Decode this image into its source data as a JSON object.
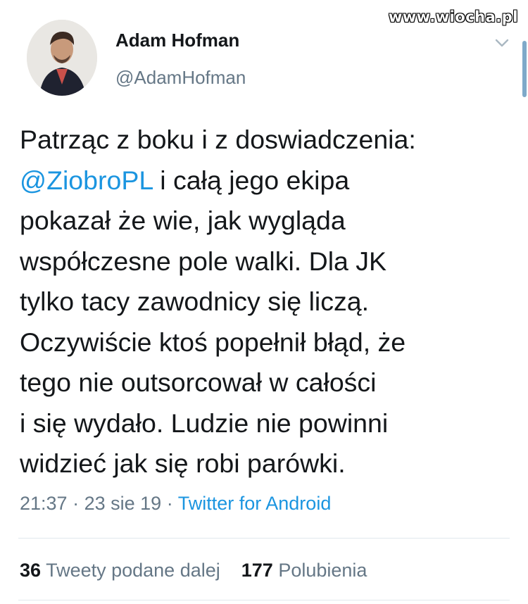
{
  "watermark": "www.wiocha.pl",
  "author": {
    "name": "Adam Hofman",
    "handle": "@AdamHofman"
  },
  "tweet": {
    "lines": [
      "Patrząc z boku i z doswiadczenia:",
      "i całą jego ekipa",
      "pokazał że wie, jak wygląda",
      "współczesne pole walki. Dla JK",
      "tylko tacy zawodnicy się liczą.",
      "Oczywiście ktoś popełnił błąd, że",
      "tego nie outsorcował w całości",
      "i się wydało. Ludzie nie powinni",
      "widzieć jak się robi parówki."
    ],
    "mention": "@ZiobroPL"
  },
  "meta": {
    "time": "21:37",
    "date": "23 sie 19",
    "separator": "·",
    "source": "Twitter for Android"
  },
  "stats": {
    "retweets_count": "36",
    "retweets_label": "Tweety podane dalej",
    "likes_count": "177",
    "likes_label": "Polubienia"
  },
  "colors": {
    "link": "#1b95e0",
    "secondary_text": "#657786",
    "primary_text": "#14171a"
  },
  "icons": {
    "more": "chevron-down-icon"
  }
}
